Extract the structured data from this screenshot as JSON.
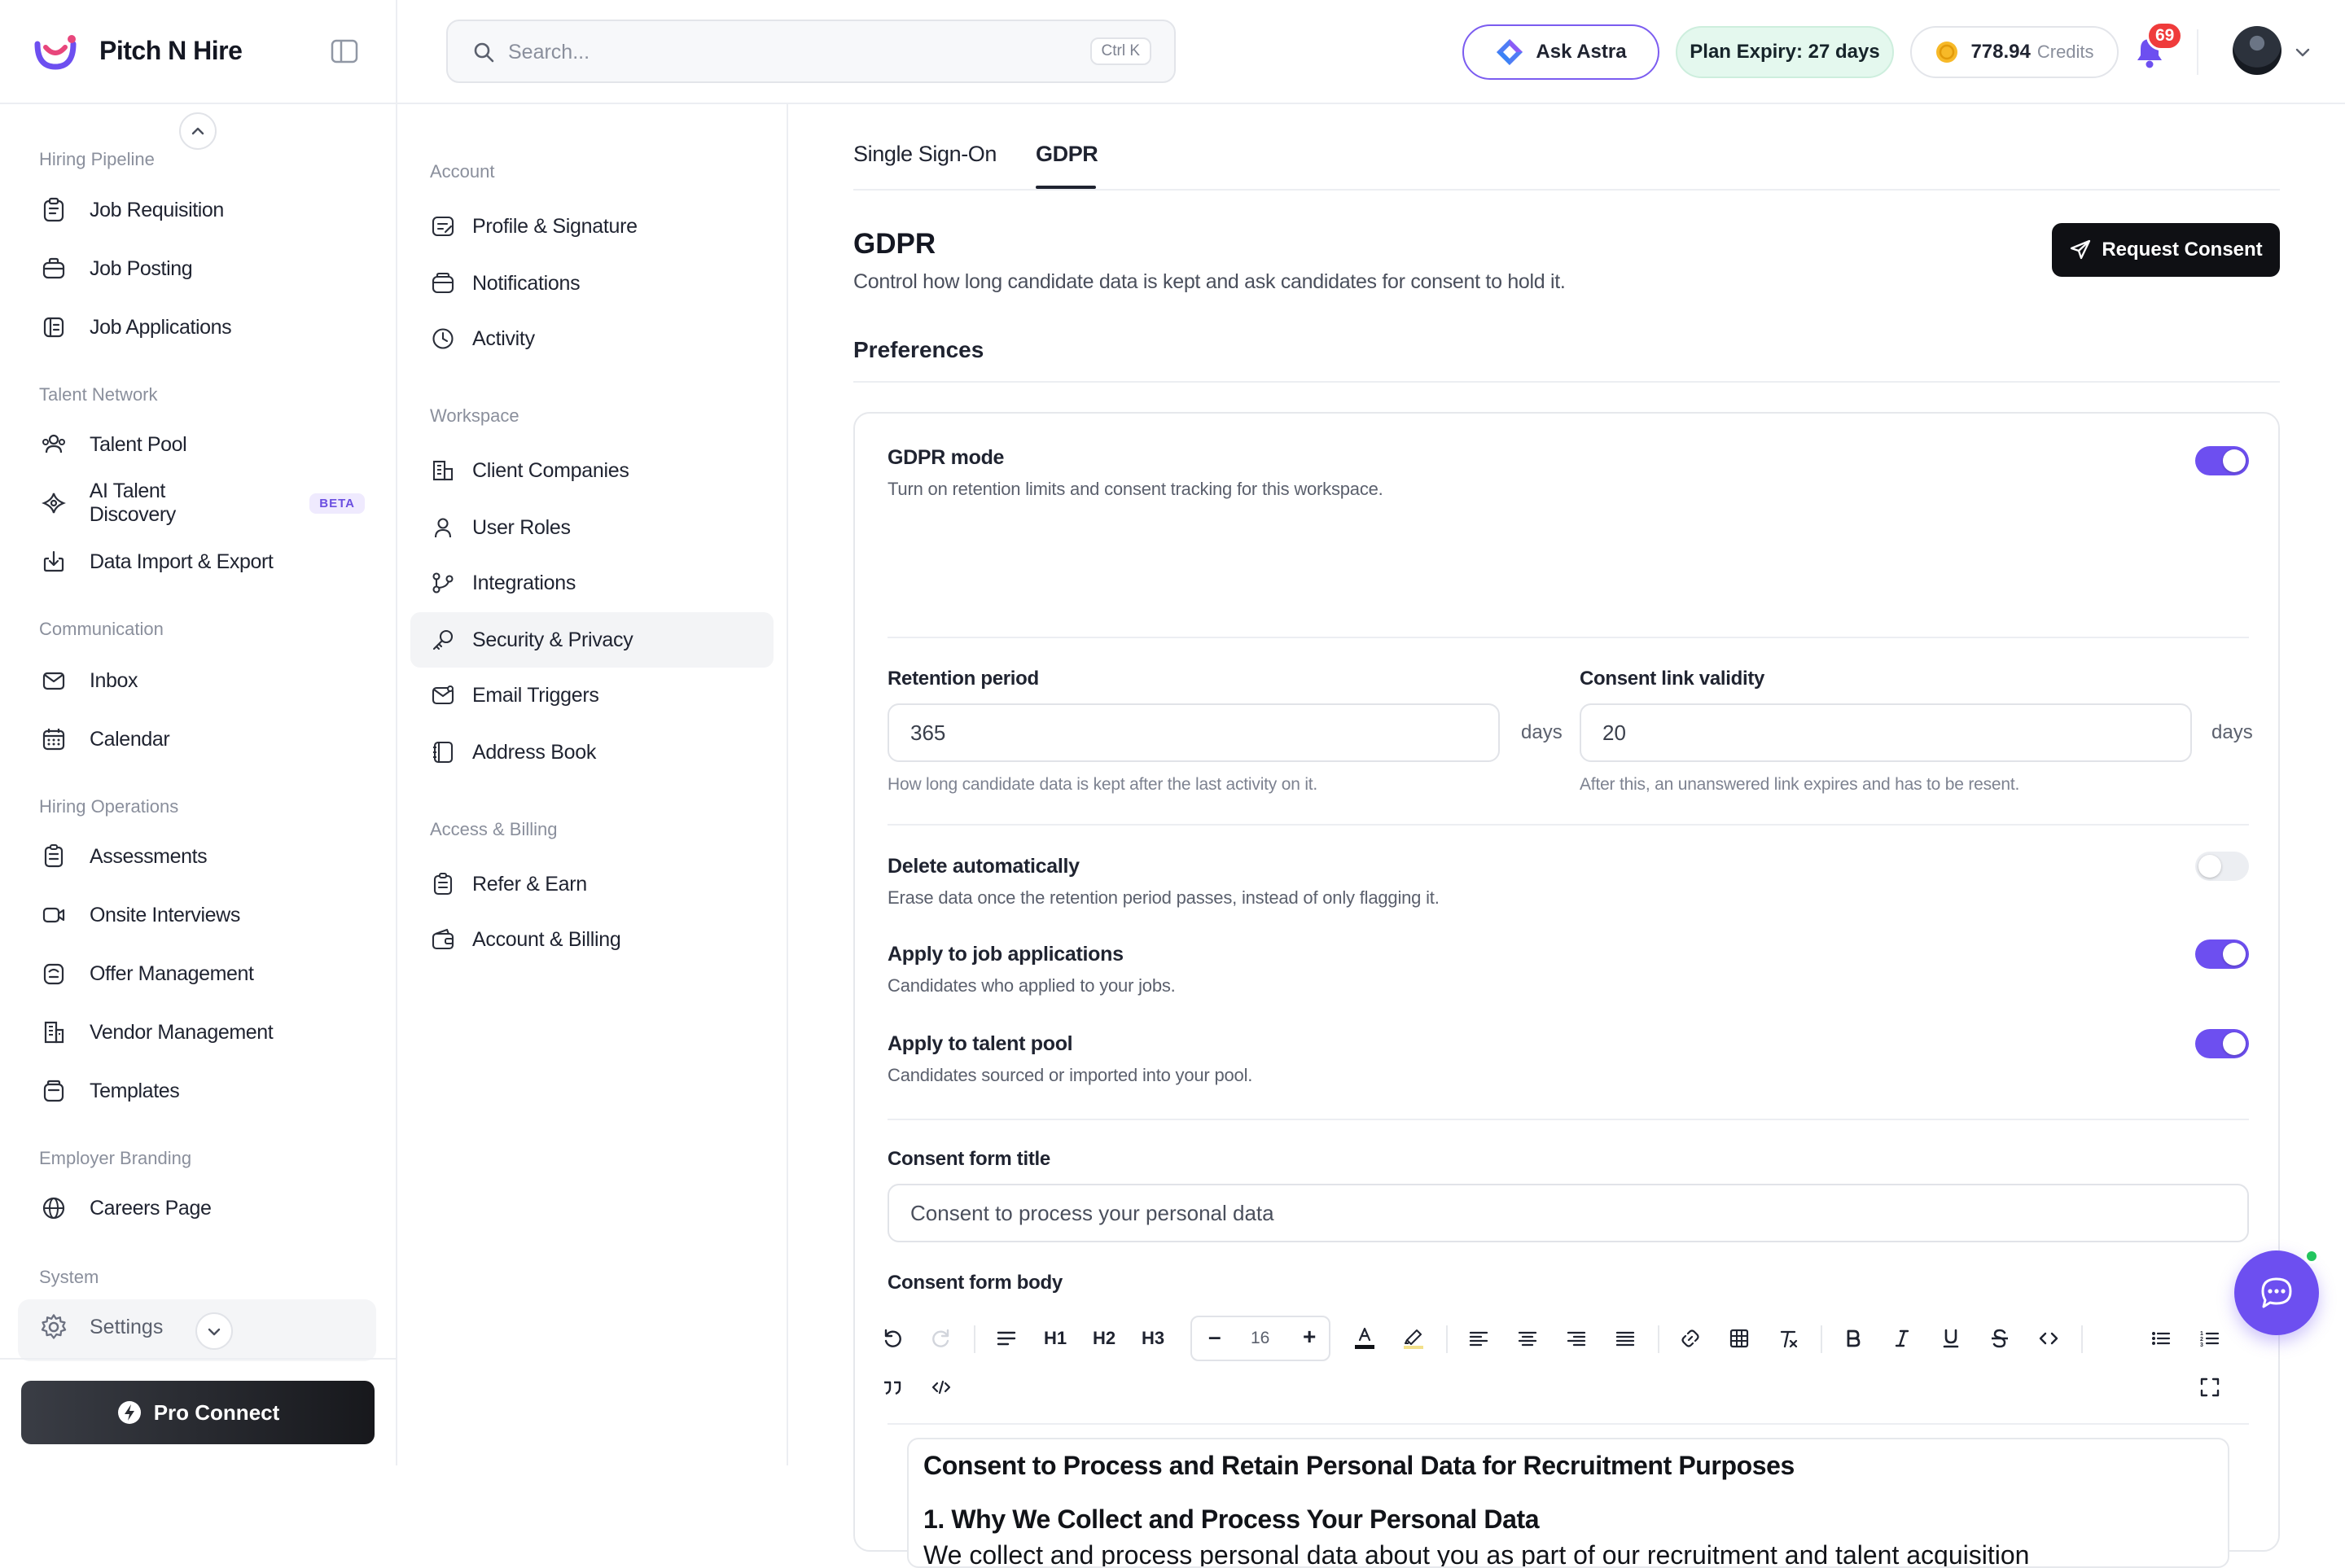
{
  "brand": {
    "name": "Pitch N Hire"
  },
  "sidebar": {
    "groups": [
      {
        "label": "Hiring Pipeline",
        "items": [
          {
            "label": "Job Requisition",
            "icon": "clipboard-icon"
          },
          {
            "label": "Job Posting",
            "icon": "briefcase-icon"
          },
          {
            "label": "Job Applications",
            "icon": "applications-icon"
          }
        ]
      },
      {
        "label": "Talent Network",
        "items": [
          {
            "label": "Talent Pool",
            "icon": "users-icon"
          },
          {
            "label": "AI Talent Discovery",
            "icon": "sparkle-icon",
            "badge": "BETA"
          },
          {
            "label": "Data Import & Export",
            "icon": "import-icon"
          }
        ]
      },
      {
        "label": "Communication",
        "items": [
          {
            "label": "Inbox",
            "icon": "mail-icon"
          },
          {
            "label": "Calendar",
            "icon": "calendar-icon"
          }
        ]
      },
      {
        "label": "Hiring Operations",
        "items": [
          {
            "label": "Assessments",
            "icon": "assessment-icon"
          },
          {
            "label": "Onsite Interviews",
            "icon": "video-icon"
          },
          {
            "label": "Offer Management",
            "icon": "offer-icon"
          },
          {
            "label": "Vendor Management",
            "icon": "building-icon"
          },
          {
            "label": "Templates",
            "icon": "templates-icon"
          }
        ]
      },
      {
        "label": "Employer Branding",
        "items": [
          {
            "label": "Careers Page",
            "icon": "globe-icon"
          }
        ]
      },
      {
        "label": "System",
        "items": []
      }
    ],
    "settings_label": "Settings",
    "pro_connect_label": "Pro Connect"
  },
  "topbar": {
    "search_placeholder": "Search...",
    "search_shortcut": "Ctrl K",
    "ask_astra_label": "Ask Astra",
    "plan_expiry": "Plan Expiry: 27 days",
    "credits_value": "778.94",
    "credits_label": "Credits",
    "notification_count": "69"
  },
  "subnav": {
    "groups": [
      {
        "label": "Account",
        "items": [
          {
            "label": "Profile & Signature",
            "icon": "profile-card-icon"
          },
          {
            "label": "Notifications",
            "icon": "inbox-tray-icon"
          },
          {
            "label": "Activity",
            "icon": "clock-icon"
          }
        ]
      },
      {
        "label": "Workspace",
        "items": [
          {
            "label": "Client Companies",
            "icon": "building-icon"
          },
          {
            "label": "User Roles",
            "icon": "user-icon"
          },
          {
            "label": "Integrations",
            "icon": "integrations-icon"
          },
          {
            "label": "Security & Privacy",
            "icon": "key-icon",
            "active": true
          },
          {
            "label": "Email Triggers",
            "icon": "email-trigger-icon"
          },
          {
            "label": "Address Book",
            "icon": "address-book-icon"
          }
        ]
      },
      {
        "label": "Access & Billing",
        "items": [
          {
            "label": "Refer & Earn",
            "icon": "refer-icon"
          },
          {
            "label": "Account & Billing",
            "icon": "wallet-icon"
          }
        ]
      }
    ]
  },
  "main": {
    "tabs": [
      {
        "label": "Single Sign-On",
        "active": false
      },
      {
        "label": "GDPR",
        "active": true
      }
    ],
    "title": "GDPR",
    "subtitle": "Control how long candidate data is kept and ask candidates for consent to hold it.",
    "request_consent_label": "Request Consent",
    "section_title": "Preferences",
    "gdpr_mode": {
      "title": "GDPR mode",
      "desc": "Turn on retention limits and consent tracking for this workspace.",
      "enabled": true
    },
    "retention": {
      "label": "Retention period",
      "value": "365",
      "unit": "days",
      "hint": "How long candidate data is kept after the last activity on it."
    },
    "consent_validity": {
      "label": "Consent link validity",
      "value": "20",
      "unit": "days",
      "hint": "After this, an unanswered link expires and has to be resent."
    },
    "delete_auto": {
      "title": "Delete automatically",
      "desc": "Erase data once the retention period passes, instead of only flagging it.",
      "enabled": false
    },
    "apply_jobs": {
      "title": "Apply to job applications",
      "desc": "Candidates who applied to your jobs.",
      "enabled": true
    },
    "apply_pool": {
      "title": "Apply to talent pool",
      "desc": "Candidates sourced or imported into your pool.",
      "enabled": true
    },
    "consent_form_title": {
      "label": "Consent form title",
      "value": "Consent to process your personal data"
    },
    "consent_form_body": {
      "label": "Consent form body",
      "font_size": "16",
      "toolbar": {
        "h1": "H1",
        "h2": "H2",
        "h3": "H3"
      },
      "heading": "Consent to Process and Retain Personal Data for Recruitment Purposes",
      "section_heading": "1. Why We Collect and Process Your Personal Data",
      "paragraph": "We collect and process personal data about you as part of our recruitment and talent acquisition"
    }
  },
  "colors": {
    "accent": "#6d4ff0",
    "toggle_off": "#eceef2",
    "plan_badge_bg": "#e4f8ee",
    "notification_badge": "#ef3b3b"
  }
}
